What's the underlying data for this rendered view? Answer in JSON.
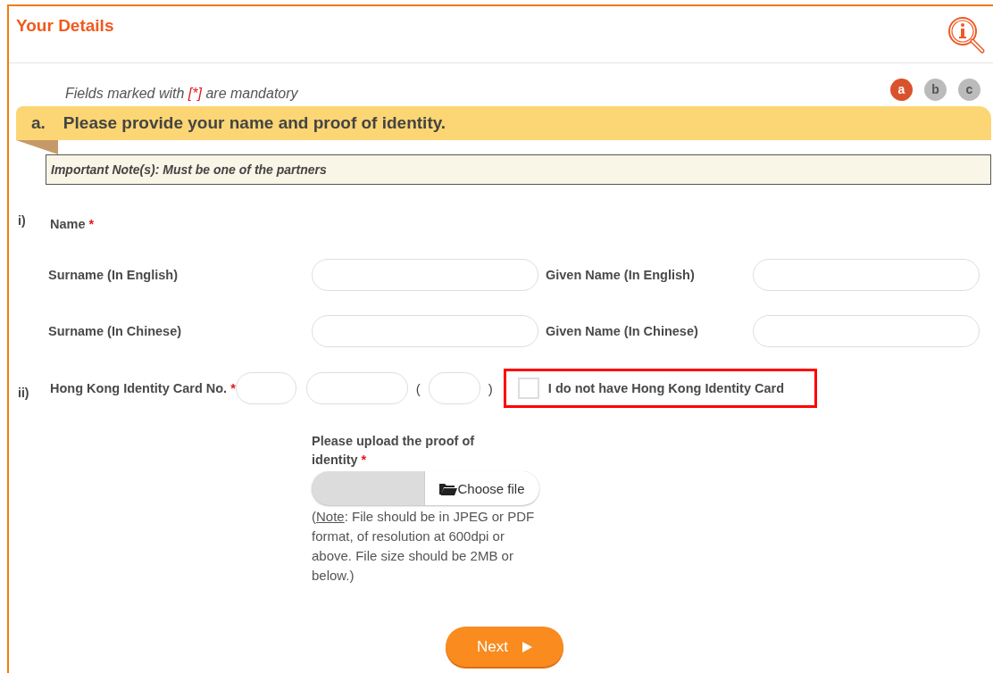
{
  "title": "Your Details",
  "mandatory_note": {
    "before": "Fields marked with",
    "mark": "[*]",
    "after": "are mandatory"
  },
  "steps": [
    {
      "label": "a",
      "selected": true
    },
    {
      "label": "b",
      "selected": false
    },
    {
      "label": "c",
      "selected": false
    }
  ],
  "section": {
    "letter": "a.",
    "heading": "Please provide your name and proof of identity."
  },
  "important_note": "Important Note(s): Must be one of the partners",
  "name_block": {
    "number": "i)",
    "label": "Name",
    "required_mark": "*",
    "rows": [
      {
        "label": "Surname (In English)",
        "label2": "Given Name (In English)"
      },
      {
        "label": "Surname (In Chinese)",
        "label2": "Given Name (In Chinese)"
      }
    ]
  },
  "hkid": {
    "number": "ii)",
    "label": "Hong Kong Identity Card No.",
    "required_mark": "*",
    "open_paren": "(",
    "close_paren": ")",
    "no_card": {
      "label": "I do not have Hong Kong Identity Card",
      "checked": false,
      "highlighted": true
    }
  },
  "upload": {
    "label": "Please upload the proof of identity",
    "required_mark": "*",
    "button": "Choose file",
    "note_open": "(",
    "note_link": "Note",
    "note_text": ": File should be in JPEG or PDF format, of resolution at 600dpi or above. File size should be 2MB or below.)"
  },
  "next_button": "Next"
}
